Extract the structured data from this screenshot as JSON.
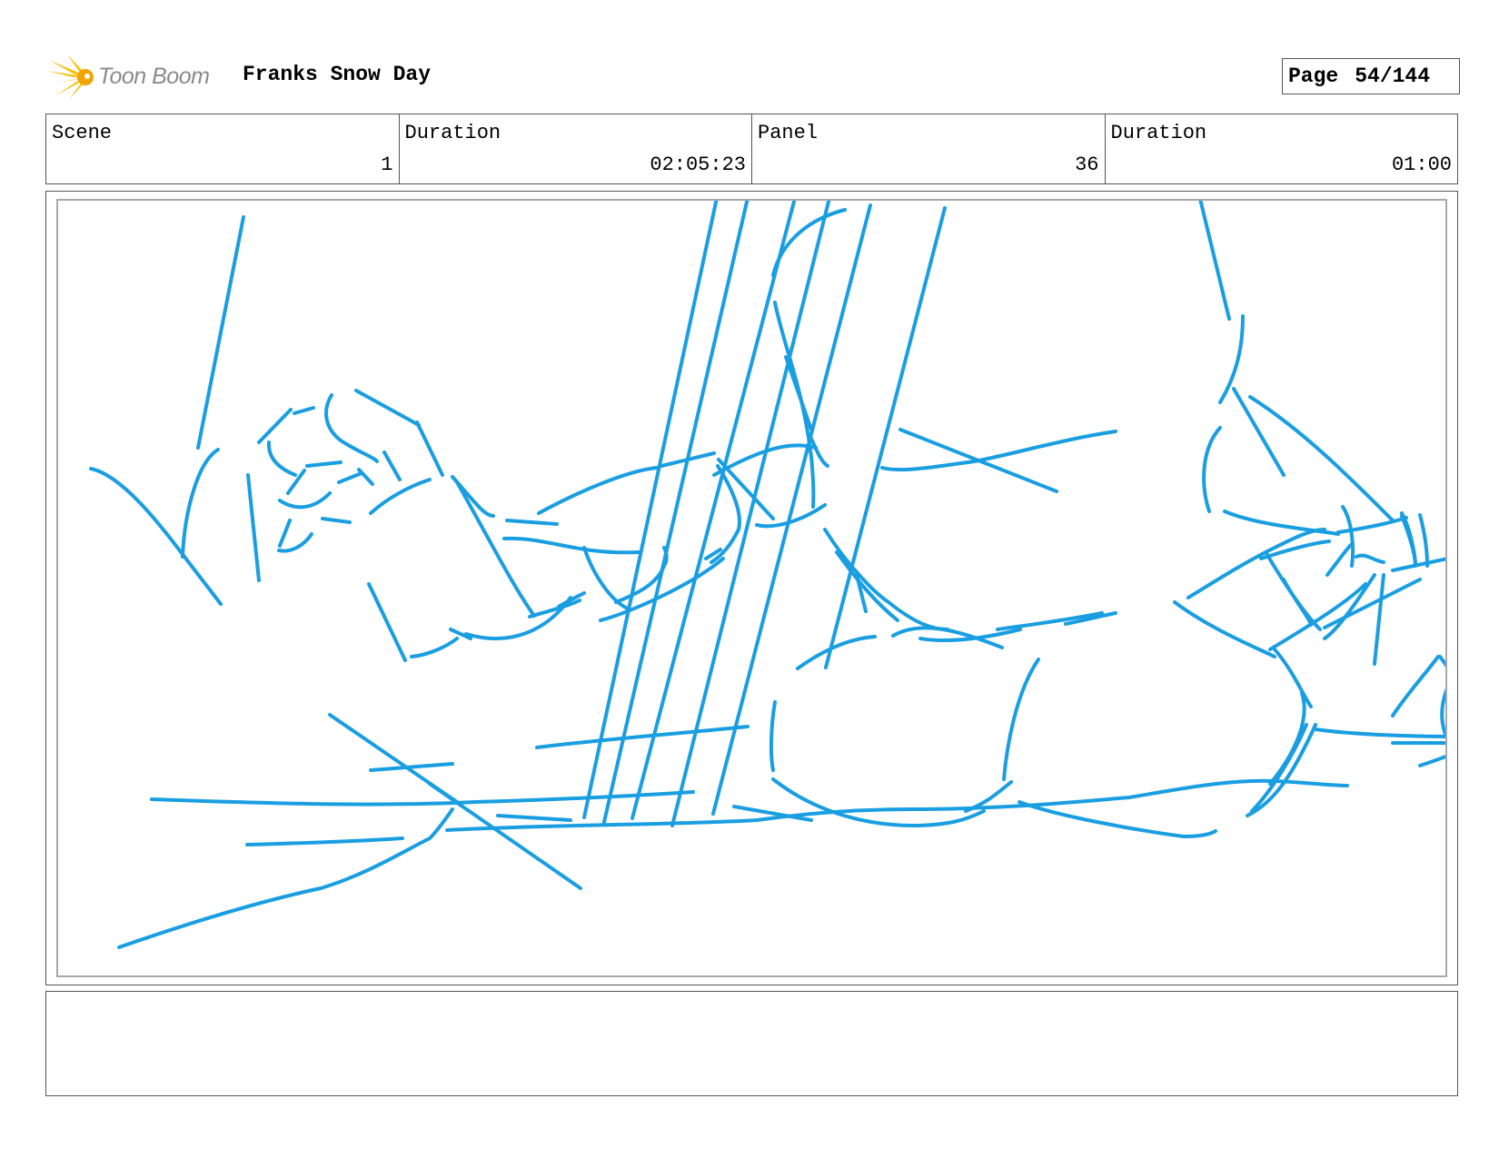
{
  "header": {
    "logo_text": "Toon Boom",
    "project_title": "Franks Snow Day",
    "page_label": "Page",
    "page_value": "54/144"
  },
  "info": {
    "scene_label": "Scene",
    "scene_value": "1",
    "scene_duration_label": "Duration",
    "scene_duration_value": "02:05:23",
    "panel_label": "Panel",
    "panel_value": "36",
    "panel_duration_label": "Duration",
    "panel_duration_value": "01:00"
  },
  "sketch": {
    "stroke_color": "#1a9ee2"
  },
  "notes": {
    "text": ""
  }
}
